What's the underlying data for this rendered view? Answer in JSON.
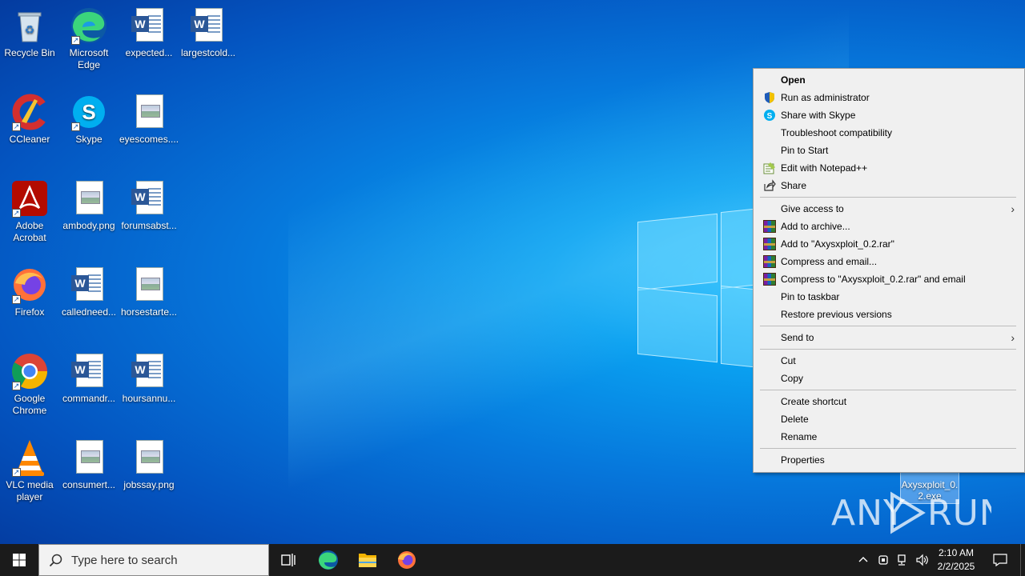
{
  "desktop": {
    "icons": [
      {
        "label": "Recycle Bin",
        "icon": "recycle-bin-icon"
      },
      {
        "label": "Microsoft Edge",
        "icon": "edge-icon"
      },
      {
        "label": "expected...",
        "icon": "word-doc-icon"
      },
      {
        "label": "largestcold...",
        "icon": "word-doc-icon"
      },
      {
        "label": "CCleaner",
        "icon": "ccleaner-icon"
      },
      {
        "label": "Skype",
        "icon": "skype-icon"
      },
      {
        "label": "eyescomes....",
        "icon": "image-file-icon"
      },
      {
        "label": "Adobe Acrobat",
        "icon": "acrobat-icon"
      },
      {
        "label": "ambody.png",
        "icon": "image-file-icon"
      },
      {
        "label": "forumsabst...",
        "icon": "word-doc-icon"
      },
      {
        "label": "Firefox",
        "icon": "firefox-icon"
      },
      {
        "label": "calledneed...",
        "icon": "word-doc-icon"
      },
      {
        "label": "horsestarte...",
        "icon": "image-file-icon"
      },
      {
        "label": "Google Chrome",
        "icon": "chrome-icon"
      },
      {
        "label": "commandr...",
        "icon": "word-doc-icon"
      },
      {
        "label": "hoursannu...",
        "icon": "word-doc-icon"
      },
      {
        "label": "VLC media player",
        "icon": "vlc-icon"
      },
      {
        "label": "consumert...",
        "icon": "image-file-icon"
      },
      {
        "label": "jobssay.png",
        "icon": "image-file-icon"
      }
    ],
    "selected_file": "Axysxploit_0.2.exe",
    "selected_file_line1": "Axysxploit_0.",
    "selected_file_line2": "2.exe",
    "watermark": "ANY RUN"
  },
  "context_menu": {
    "items": [
      {
        "label": "Open"
      },
      {
        "label": "Run as administrator",
        "icon": "uac-shield-icon"
      },
      {
        "label": "Share with Skype",
        "icon": "skype-icon"
      },
      {
        "label": "Troubleshoot compatibility"
      },
      {
        "label": "Pin to Start"
      },
      {
        "label": "Edit with Notepad++",
        "icon": "notepadpp-icon"
      },
      {
        "label": "Share",
        "icon": "share-icon"
      },
      {
        "label": "Give access to"
      },
      {
        "label": "Add to archive...",
        "icon": "winrar-icon"
      },
      {
        "label": "Add to \"Axysxploit_0.2.rar\"",
        "icon": "winrar-icon"
      },
      {
        "label": "Compress and email...",
        "icon": "winrar-icon"
      },
      {
        "label": "Compress to \"Axysxploit_0.2.rar\" and email",
        "icon": "winrar-icon"
      },
      {
        "label": "Pin to taskbar"
      },
      {
        "label": "Restore previous versions"
      },
      {
        "label": "Send to"
      },
      {
        "label": "Cut"
      },
      {
        "label": "Copy"
      },
      {
        "label": "Create shortcut"
      },
      {
        "label": "Delete"
      },
      {
        "label": "Rename"
      },
      {
        "label": "Properties"
      }
    ]
  },
  "taskbar": {
    "search_placeholder": "Type here to search",
    "time": "2:10 AM",
    "date": "2/2/2025",
    "pinned": [
      "task-view-icon",
      "edge-icon",
      "file-explorer-icon",
      "firefox-icon"
    ]
  },
  "colors": {
    "desktop_accent": "#0678dc",
    "taskbar": "#1b1b1b",
    "menu_bg": "#f0f0f0"
  }
}
